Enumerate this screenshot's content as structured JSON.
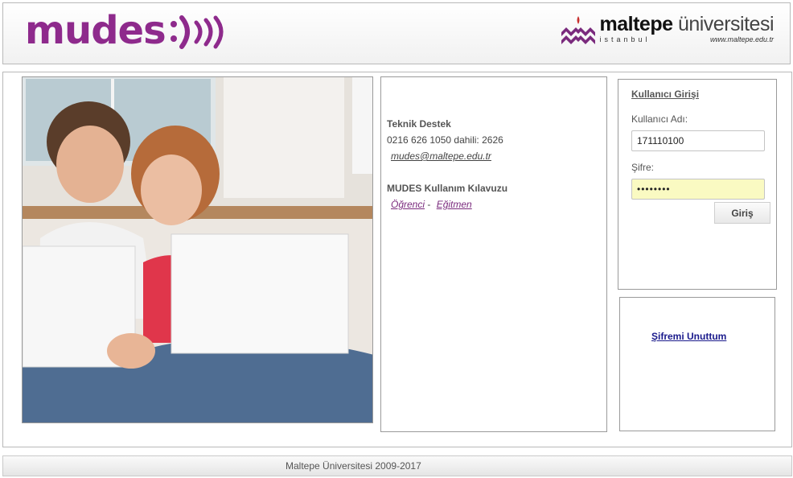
{
  "header": {
    "brand": "mudes",
    "university_name_bold": "maltepe",
    "university_name_rest": " üniversitesi",
    "university_city": "istanbul",
    "university_web": "www.maltepe.edu.tr"
  },
  "info": {
    "support_title": "Teknik Destek",
    "support_phone": "0216 626 1050 dahili: 2626",
    "support_email": "mudes@maltepe.edu.tr",
    "guide_title": "MUDES Kullanım Kılavuzu",
    "guide_student": "Öğrenci",
    "guide_separator": " - ",
    "guide_instructor": "Eğitmen"
  },
  "login": {
    "title": "Kullanıcı Girişi",
    "username_label": "Kullanıcı Adı:",
    "username_value": "171110100",
    "password_label": "Şifre:",
    "password_value": "••••••••",
    "submit_label": "Giriş"
  },
  "forgot": {
    "link": "Şifremi Unuttum"
  },
  "footer": {
    "text": "Maltepe Üniversitesi 2009-2017"
  },
  "colors": {
    "brand": "#8e2a8c",
    "link": "#7a2a7d",
    "forgot_link": "#1a1a8c",
    "password_bg": "#fafac2"
  },
  "icons": {
    "brand_mark": "smile-waves-icon",
    "university_mark": "maltepe-logo-icon"
  }
}
